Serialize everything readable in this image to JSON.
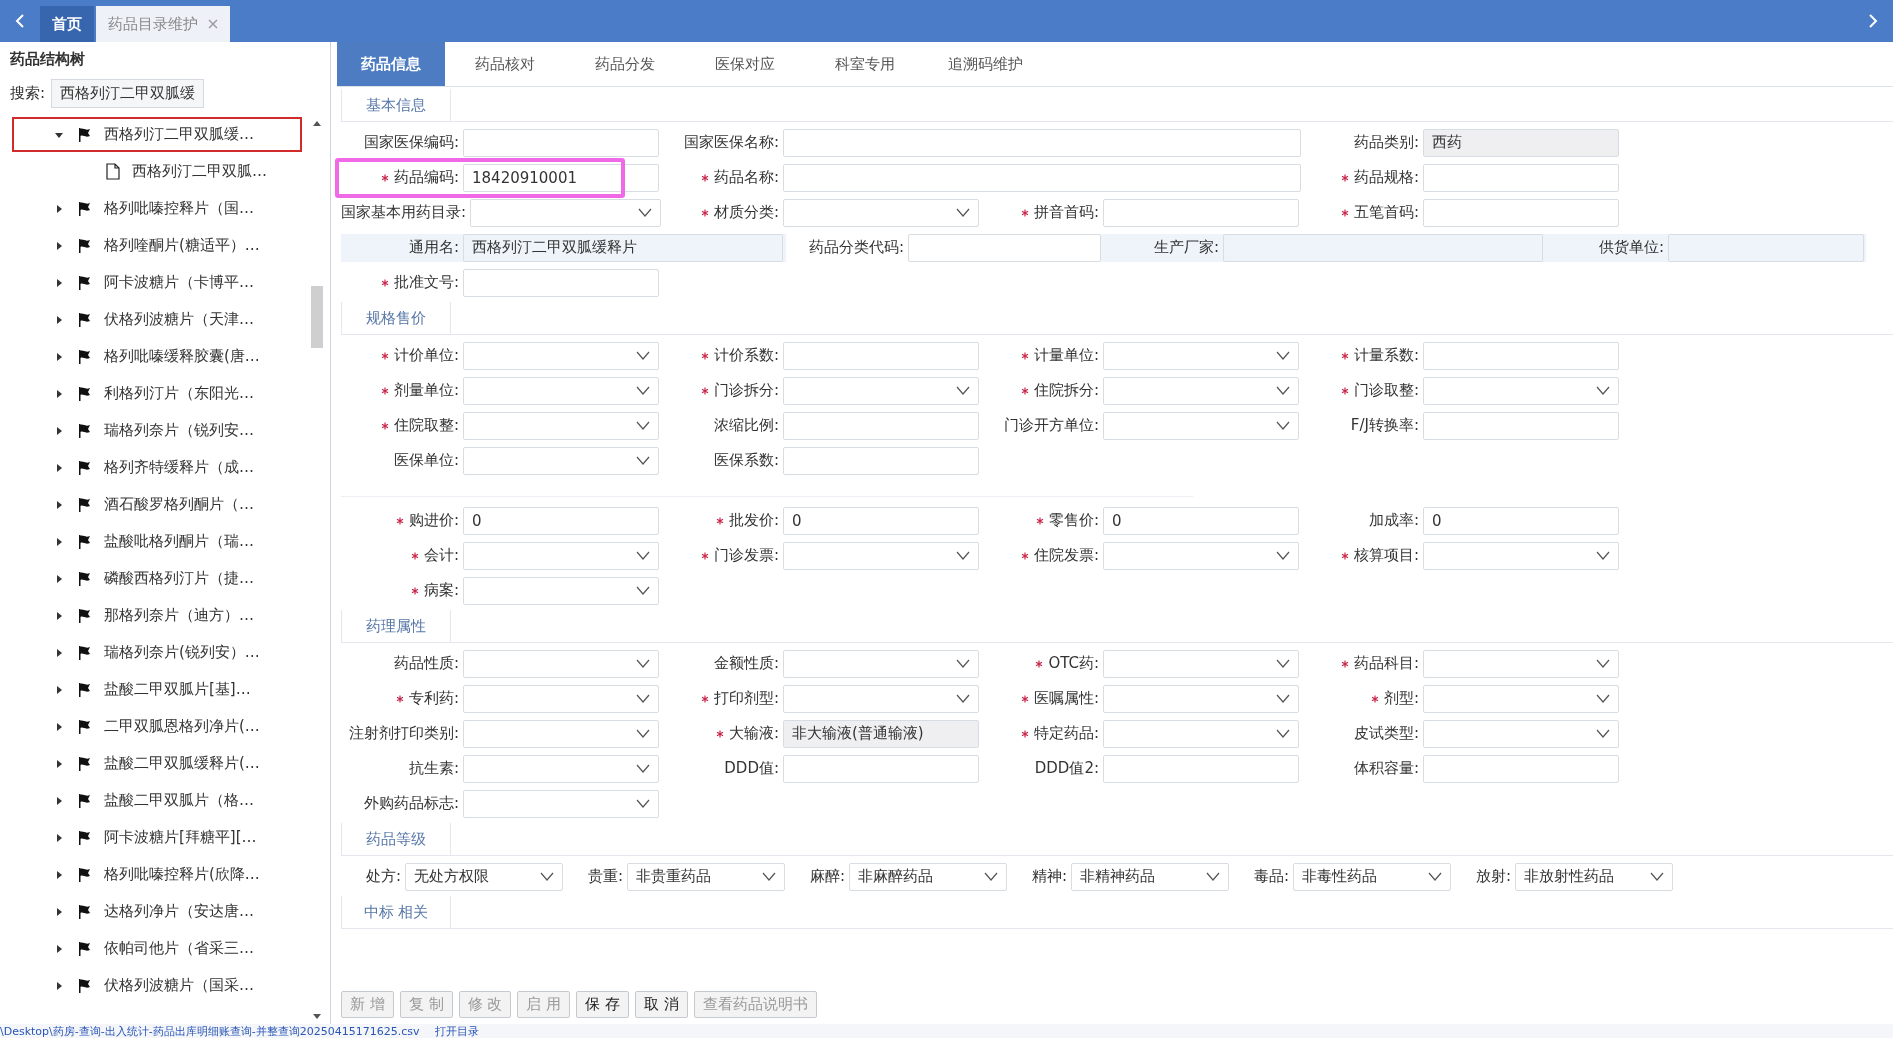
{
  "top_tabs": [
    {
      "label": "首页",
      "selected": false,
      "closable": false
    },
    {
      "label": "药品目录维护",
      "selected": true,
      "closable": true
    }
  ],
  "tree": {
    "title": "药品结构树",
    "search_label": "搜索:",
    "search_value": "西格列汀二甲双胍缓",
    "items": [
      {
        "label": "西格列汀二甲双胍缓…",
        "kind": "folder",
        "expanded": true,
        "selected": true,
        "children": [
          {
            "label": "西格列汀二甲双胍…",
            "kind": "leaf",
            "selected": false
          }
        ]
      },
      {
        "label": "格列吡嗪控释片（国…",
        "kind": "folder",
        "expanded": false,
        "selected": false
      },
      {
        "label": "格列喹酮片(糖适平）…",
        "kind": "folder",
        "expanded": false,
        "selected": false
      },
      {
        "label": "阿卡波糖片（卡博平…",
        "kind": "folder",
        "expanded": false,
        "selected": false
      },
      {
        "label": "伏格列波糖片（天津…",
        "kind": "folder",
        "expanded": false,
        "selected": false
      },
      {
        "label": "格列吡嗪缓释胶囊(唐…",
        "kind": "folder",
        "expanded": false,
        "selected": false
      },
      {
        "label": "利格列汀片（东阳光…",
        "kind": "folder",
        "expanded": false,
        "selected": false
      },
      {
        "label": "瑞格列奈片（锐列安…",
        "kind": "folder",
        "expanded": false,
        "selected": false
      },
      {
        "label": "格列齐特缓释片（成…",
        "kind": "folder",
        "expanded": false,
        "selected": false
      },
      {
        "label": "酒石酸罗格列酮片（…",
        "kind": "folder",
        "expanded": false,
        "selected": false
      },
      {
        "label": "盐酸吡格列酮片（瑞…",
        "kind": "folder",
        "expanded": false,
        "selected": false
      },
      {
        "label": "磷酸西格列汀片（捷…",
        "kind": "folder",
        "expanded": false,
        "selected": false
      },
      {
        "label": "那格列奈片（迪方）…",
        "kind": "folder",
        "expanded": false,
        "selected": false
      },
      {
        "label": "瑞格列奈片(锐列安）…",
        "kind": "folder",
        "expanded": false,
        "selected": false
      },
      {
        "label": "盐酸二甲双胍片[基]…",
        "kind": "folder",
        "expanded": false,
        "selected": false
      },
      {
        "label": "二甲双胍恩格列净片(…",
        "kind": "folder",
        "expanded": false,
        "selected": false
      },
      {
        "label": "盐酸二甲双胍缓释片(…",
        "kind": "folder",
        "expanded": false,
        "selected": false
      },
      {
        "label": "盐酸二甲双胍片（格…",
        "kind": "folder",
        "expanded": false,
        "selected": false
      },
      {
        "label": "阿卡波糖片[拜糖平][…",
        "kind": "folder",
        "expanded": false,
        "selected": false
      },
      {
        "label": "格列吡嗪控释片(欣降…",
        "kind": "folder",
        "expanded": false,
        "selected": false
      },
      {
        "label": "达格列净片（安达唐…",
        "kind": "folder",
        "expanded": false,
        "selected": false
      },
      {
        "label": "依帕司他片（省采三…",
        "kind": "folder",
        "expanded": false,
        "selected": false
      },
      {
        "label": "伏格列波糖片（国采…",
        "kind": "folder",
        "expanded": false,
        "selected": false
      }
    ]
  },
  "tabs": [
    {
      "label": "药品信息",
      "selected": true
    },
    {
      "label": "药品核对",
      "selected": false
    },
    {
      "label": "药品分发",
      "selected": false
    },
    {
      "label": "医保对应",
      "selected": false
    },
    {
      "label": "科室专用",
      "selected": false
    },
    {
      "label": "追溯码维护",
      "selected": false
    }
  ],
  "sections": [
    {
      "title": "基本信息",
      "groups": [
        [
          {
            "kind": "grid",
            "fields": [
              {
                "label": "国家医保编码:",
                "required": false,
                "kind": "input"
              },
              {
                "label": "国家医保名称:",
                "required": false,
                "kind": "wide"
              },
              {
                "label": "药品类别:",
                "required": false,
                "kind": "readonly",
                "value": "西药"
              }
            ]
          },
          {
            "kind": "grid",
            "fields": [
              {
                "label": "药品编码:",
                "required": true,
                "kind": "input",
                "value": "18420910001",
                "highlighted": true
              },
              {
                "label": "药品名称:",
                "required": true,
                "kind": "wide"
              },
              {
                "label": "药品规格:",
                "required": true,
                "kind": "input"
              }
            ]
          },
          {
            "kind": "grid",
            "fields": [
              {
                "label": "国家基本用药目录:",
                "required": false,
                "kind": "select"
              },
              {
                "label": "材质分类:",
                "required": true,
                "kind": "select"
              },
              {
                "label": "拼音首码:",
                "required": true,
                "kind": "input"
              },
              {
                "label": "五笔首码:",
                "required": true,
                "kind": "input"
              }
            ]
          },
          {
            "kind": "free",
            "fields": [
              {
                "label": "通用名:",
                "required": false,
                "kind": "filled",
                "value": "西格列汀二甲双胍缓释片"
              },
              {
                "label": "药品分类代码:",
                "required": false,
                "kind": "input"
              },
              {
                "label": "生产厂家:",
                "required": false,
                "kind": "filled"
              },
              {
                "label": "供货单位:",
                "required": false,
                "kind": "filled"
              }
            ]
          },
          {
            "kind": "grid",
            "fields": [
              {
                "label": "批准文号:",
                "required": true,
                "kind": "input"
              }
            ]
          }
        ]
      ]
    },
    {
      "title": "规格售价",
      "groups": [
        [
          {
            "kind": "grid",
            "fields": [
              {
                "label": "计价单位:",
                "required": true,
                "kind": "select"
              },
              {
                "label": "计价系数:",
                "required": true,
                "kind": "input"
              },
              {
                "label": "计量单位:",
                "required": true,
                "kind": "select"
              },
              {
                "label": "计量系数:",
                "required": true,
                "kind": "input"
              }
            ]
          },
          {
            "kind": "grid",
            "fields": [
              {
                "label": "剂量单位:",
                "required": true,
                "kind": "select"
              },
              {
                "label": "门诊拆分:",
                "required": true,
                "kind": "select"
              },
              {
                "label": "住院拆分:",
                "required": true,
                "kind": "select"
              },
              {
                "label": "门诊取整:",
                "required": true,
                "kind": "select"
              }
            ]
          },
          {
            "kind": "grid",
            "fields": [
              {
                "label": "住院取整:",
                "required": true,
                "kind": "select"
              },
              {
                "label": "浓缩比例:",
                "required": false,
                "kind": "input"
              },
              {
                "label": "门诊开方单位:",
                "required": false,
                "kind": "select"
              },
              {
                "label": "F/J转换率:",
                "required": false,
                "kind": "input"
              }
            ]
          },
          {
            "kind": "grid",
            "fields": [
              {
                "label": "医保单位:",
                "required": false,
                "kind": "select"
              },
              {
                "label": "医保系数:",
                "required": false,
                "kind": "input"
              }
            ]
          }
        ],
        [
          {
            "kind": "grid",
            "fields": [
              {
                "label": "购进价:",
                "required": true,
                "kind": "input",
                "value": "0"
              },
              {
                "label": "批发价:",
                "required": true,
                "kind": "input",
                "value": "0"
              },
              {
                "label": "零售价:",
                "required": true,
                "kind": "input",
                "value": "0"
              },
              {
                "label": "加成率:",
                "required": false,
                "kind": "input",
                "value": "0"
              }
            ]
          },
          {
            "kind": "grid",
            "fields": [
              {
                "label": "会计:",
                "required": true,
                "kind": "select"
              },
              {
                "label": "门诊发票:",
                "required": true,
                "kind": "select"
              },
              {
                "label": "住院发票:",
                "required": true,
                "kind": "select"
              },
              {
                "label": "核算项目:",
                "required": true,
                "kind": "select"
              }
            ]
          },
          {
            "kind": "grid",
            "fields": [
              {
                "label": "病案:",
                "required": true,
                "kind": "select"
              }
            ]
          }
        ]
      ]
    },
    {
      "title": "药理属性",
      "groups": [
        [
          {
            "kind": "grid",
            "fields": [
              {
                "label": "药品性质:",
                "required": false,
                "kind": "select"
              },
              {
                "label": "金额性质:",
                "required": false,
                "kind": "select"
              },
              {
                "label": "OTC药:",
                "required": true,
                "kind": "select"
              },
              {
                "label": "药品科目:",
                "required": true,
                "kind": "select"
              }
            ]
          },
          {
            "kind": "grid",
            "fields": [
              {
                "label": "专利药:",
                "required": true,
                "kind": "select"
              },
              {
                "label": "打印剂型:",
                "required": true,
                "kind": "select"
              },
              {
                "label": "医嘱属性:",
                "required": true,
                "kind": "select"
              },
              {
                "label": "剂型:",
                "required": true,
                "kind": "select"
              }
            ]
          },
          {
            "kind": "grid",
            "fields": [
              {
                "label": "注射剂打印类别:",
                "required": false,
                "kind": "select"
              },
              {
                "label": "大输液:",
                "required": true,
                "kind": "readonly",
                "value": "非大输液(普通输液)"
              },
              {
                "label": "特定药品:",
                "required": true,
                "kind": "select"
              },
              {
                "label": "皮试类型:",
                "required": false,
                "kind": "select"
              }
            ]
          },
          {
            "kind": "grid",
            "fields": [
              {
                "label": "抗生素:",
                "required": false,
                "kind": "select"
              },
              {
                "label": "DDD值:",
                "required": false,
                "kind": "input"
              },
              {
                "label": "DDD值2:",
                "required": false,
                "kind": "input"
              },
              {
                "label": "体积容量:",
                "required": false,
                "kind": "input"
              }
            ]
          },
          {
            "kind": "grid",
            "fields": [
              {
                "label": "外购药品标志:",
                "required": false,
                "kind": "select"
              }
            ]
          }
        ]
      ]
    },
    {
      "title": "药品等级",
      "groups": [
        [
          {
            "kind": "compact",
            "fields": [
              {
                "label": "处方:",
                "required": false,
                "kind": "select",
                "value": "无处方权限"
              },
              {
                "label": "贵重:",
                "required": false,
                "kind": "select",
                "value": "非贵重药品"
              },
              {
                "label": "麻醉:",
                "required": false,
                "kind": "select",
                "value": "非麻醉药品"
              },
              {
                "label": "精神:",
                "required": false,
                "kind": "select",
                "value": "非精神药品"
              },
              {
                "label": "毒品:",
                "required": false,
                "kind": "select",
                "value": "非毒性药品"
              },
              {
                "label": "放射:",
                "required": false,
                "kind": "select",
                "value": "非放射性药品"
              }
            ]
          }
        ]
      ]
    },
    {
      "title": "中标 相关"
    }
  ],
  "buttons": [
    {
      "label": "新 增",
      "disabled": true
    },
    {
      "label": "复 制",
      "disabled": true
    },
    {
      "label": "修 改",
      "disabled": true
    },
    {
      "label": "启 用",
      "disabled": true
    },
    {
      "label": "保 存",
      "disabled": false
    },
    {
      "label": "取 消",
      "disabled": false
    },
    {
      "label": "查看药品说明书",
      "disabled": true
    }
  ],
  "status_bar": {
    "path": "\\Desktop\\药房-查询-出入统计-药品出库明细账查询-并整查询20250415171625.csv",
    "link": "打开目录"
  }
}
